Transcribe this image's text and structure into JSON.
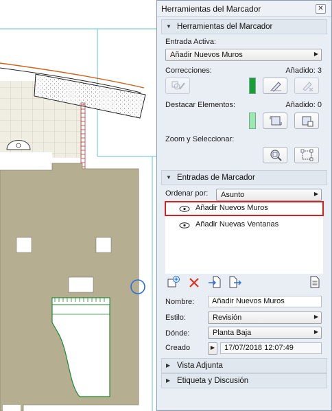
{
  "palette": {
    "window_title": "Herramientas del Marcador",
    "close_glyph": "✕",
    "tools_section": {
      "title": "Herramientas del Marcador",
      "entrada_label": "Entrada Activa:",
      "entrada_value": "Añadir Nuevos Muros",
      "correcciones_label": "Correcciones:",
      "correcciones_count": "Añadido: 3",
      "destacar_label": "Destacar Elementos:",
      "destacar_count": "Añadido: 0",
      "zoom_label": "Zoom y Seleccionar:",
      "colors": {
        "correction_swatch": "#1a9e3a",
        "highlight_swatch": "#9be8b2"
      }
    },
    "entries_section": {
      "title": "Entradas de Marcador",
      "ordenar_label": "Ordenar por:",
      "ordenar_value": "Asunto",
      "items": [
        {
          "label": "Añadir Nuevos Muros",
          "selected": true
        },
        {
          "label": "Añadir Nuevas Ventanas",
          "selected": false
        }
      ],
      "toolbar_icons": [
        "new-entry-icon",
        "delete-icon",
        "import-icon",
        "export-icon",
        "report-icon"
      ]
    },
    "details": {
      "nombre_label": "Nombre:",
      "nombre_value": "Añadir Nuevos Muros",
      "estilo_label": "Estilo:",
      "estilo_value": "Revisión",
      "donde_label": "Dónde:",
      "donde_value": "Planta Baja",
      "creado_label": "Creado",
      "creado_value": "17/07/2018 12:07:49"
    },
    "vista_section": {
      "title": "Vista Adjunta"
    },
    "etiqueta_section": {
      "title": "Etiqueta y Discusión"
    }
  }
}
